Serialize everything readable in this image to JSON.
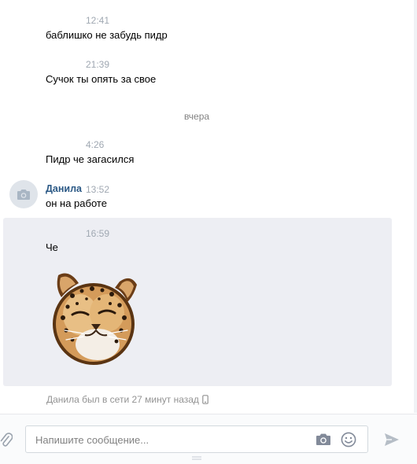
{
  "messages": [
    {
      "time": "12:41",
      "text": "баблишко не забудь пидр"
    },
    {
      "time": "21:39",
      "text": "Сучок ты опять за свое"
    },
    {
      "time": "4:26",
      "text": "Пидр че загасился"
    }
  ],
  "date_separator": "вчера",
  "group": {
    "sender": "Данила",
    "time": "13:52",
    "text": "он на работе"
  },
  "highlighted": {
    "time": "16:59",
    "text": "Че"
  },
  "status": "Данила был в сети 27 минут назад",
  "composer": {
    "placeholder": "Напишите сообщение..."
  },
  "icons": {
    "avatar": "camera-icon",
    "status": "mobile-phone-icon",
    "attach": "paperclip-icon",
    "photo": "camera-icon",
    "emoji": "smile-icon",
    "send": "send-arrow-icon"
  },
  "colors": {
    "accent": "#2a5885",
    "highlight_bg": "#edeef3",
    "time": "#a0a8b2"
  }
}
